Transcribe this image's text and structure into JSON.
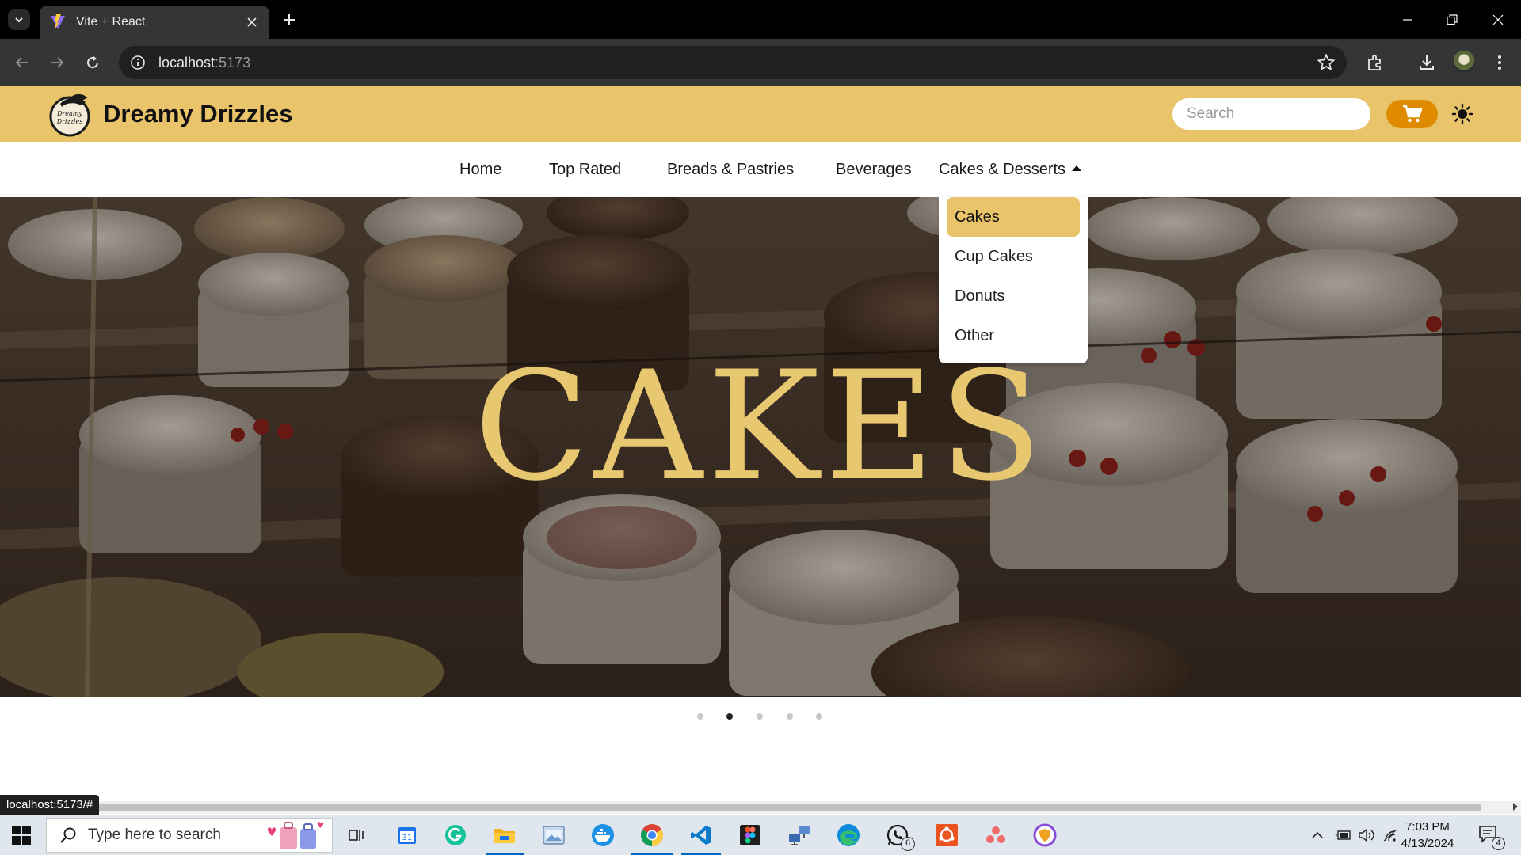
{
  "browser": {
    "tab_title": "Vite + React",
    "url_host": "localhost",
    "url_port": ":5173",
    "status_url": "localhost:5173/#"
  },
  "site": {
    "brand": "Dreamy Drizzles",
    "logo_text": "Dreamy Drizzles",
    "search_placeholder": "Search",
    "accent_color": "#e9c46a",
    "cart_color": "#e08a00"
  },
  "nav": {
    "items": [
      {
        "label": "Home"
      },
      {
        "label": "Top Rated"
      },
      {
        "label": "Breads & Pastries"
      },
      {
        "label": "Beverages"
      },
      {
        "label": "Cakes & Desserts"
      }
    ],
    "dropdown": {
      "items": [
        {
          "label": "Cakes",
          "active": true
        },
        {
          "label": "Cup Cakes",
          "active": false
        },
        {
          "label": "Donuts",
          "active": false
        },
        {
          "label": "Other",
          "active": false
        }
      ]
    }
  },
  "hero": {
    "title": "CAKES",
    "slide_count": 5,
    "active_slide": 2
  },
  "taskbar": {
    "search_placeholder": "Type here to search",
    "time": "7:03 PM",
    "date": "4/13/2024",
    "whatsapp_badge": "6",
    "notification_count": "4"
  }
}
